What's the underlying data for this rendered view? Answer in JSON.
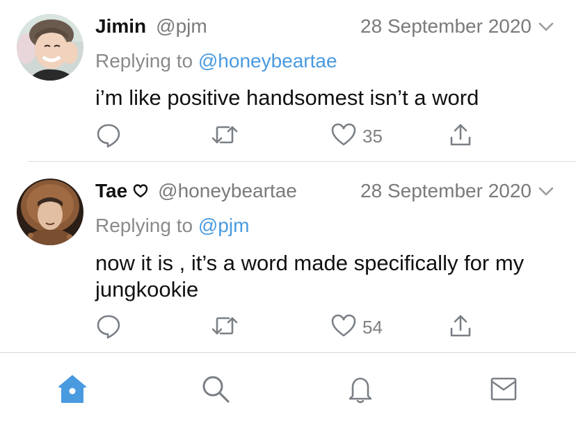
{
  "tweets": [
    {
      "name": "Jimin",
      "handle": "@pjm",
      "date": "28 September 2020",
      "replying_prefix": "Replying to ",
      "replying_to": "@honeybeartae",
      "text": "i’m like positive handsomest isn’t a word",
      "like_count": "35"
    },
    {
      "name": "Tae",
      "handle": "@honeybeartae",
      "date": "28 September 2020",
      "replying_prefix": "Replying to ",
      "replying_to": "@pjm",
      "text": "now it is , it’s a word made specifically for my jungkookie",
      "like_count": "54"
    }
  ],
  "icons": {
    "reply": "speech-bubble-icon",
    "retweet": "retweet-arrows-icon",
    "like": "heart-outline-icon",
    "share": "share-upload-icon",
    "name_badge": "heart-outline-icon",
    "caret": "chevron-down-icon"
  },
  "tabbar": {
    "tabs": [
      {
        "icon": "home-icon",
        "active": true
      },
      {
        "icon": "search-icon",
        "active": false
      },
      {
        "icon": "bell-icon",
        "active": false
      },
      {
        "icon": "envelope-icon",
        "active": false
      }
    ]
  },
  "colors": {
    "accent": "#4a9ae0",
    "icon_gray": "#7a7f85",
    "text_secondary": "#7a7a7a"
  }
}
